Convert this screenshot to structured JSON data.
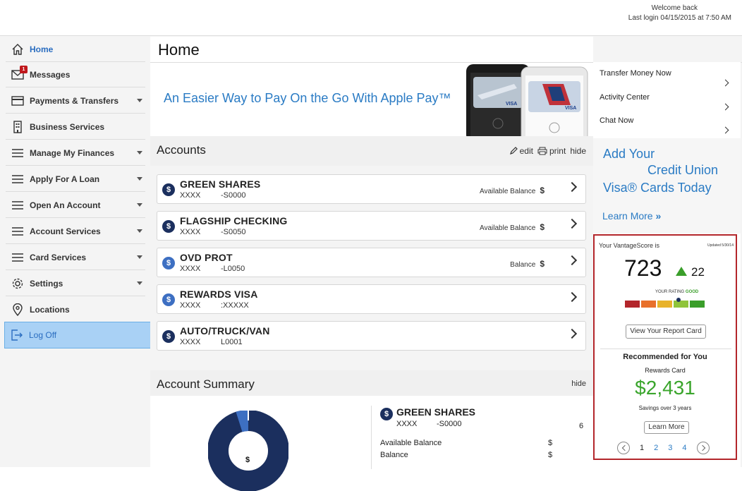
{
  "header": {
    "welcome": "Welcome back",
    "last_login": "Last login 04/15/2015 at 7:50 AM"
  },
  "sidebar": {
    "items": [
      {
        "label": "Home",
        "icon": "home-icon"
      },
      {
        "label": "Messages",
        "icon": "envelope-icon",
        "badge": "1"
      },
      {
        "label": "Payments & Transfers",
        "icon": "credit-card-icon"
      },
      {
        "label": "Business Services",
        "icon": "building-icon"
      },
      {
        "label": "Manage My Finances",
        "icon": "menu-icon"
      },
      {
        "label": "Apply For A Loan",
        "icon": "menu-icon"
      },
      {
        "label": "Open An Account",
        "icon": "menu-icon"
      },
      {
        "label": "Account Services",
        "icon": "menu-icon"
      },
      {
        "label": "Card Services",
        "icon": "menu-icon"
      },
      {
        "label": "Settings",
        "icon": "gear-icon"
      },
      {
        "label": "Locations",
        "icon": "location-pin-icon"
      },
      {
        "label": "Log Off",
        "icon": "logout-icon"
      }
    ]
  },
  "main": {
    "title": "Home",
    "promo": {
      "text": "An Easier Way to Pay On the Go With Apple Pay™",
      "card_brand": "VISA"
    },
    "accounts": {
      "title": "Accounts",
      "edit": "edit",
      "print": "print",
      "hide": "hide",
      "list": [
        {
          "name": "GREEN SHARES",
          "num_a": "XXXX",
          "num_b": "-S0000",
          "balance_label": "Available Balance",
          "balance": "$"
        },
        {
          "name": "FLAGSHIP CHECKING",
          "num_a": "XXXX",
          "num_b": "-S0050",
          "balance_label": "Available Balance",
          "balance": "$"
        },
        {
          "name": "OVD PROT",
          "num_a": "XXXX",
          "num_b": "-L0050",
          "balance_label": "Balance",
          "balance": "$"
        },
        {
          "name": "REWARDS VISA",
          "num_a": "XXXX",
          "num_b": ":XXXXX",
          "balance_label": "",
          "balance": ""
        },
        {
          "name": "AUTO/TRUCK/VAN",
          "num_a": "XXXX",
          "num_b": "L0001",
          "balance_label": "",
          "balance": ""
        }
      ]
    },
    "summary": {
      "title": "Account Summary",
      "hide": "hide",
      "donut_center": "$",
      "account": {
        "name": "GREEN SHARES",
        "num_a": "XXXX",
        "num_b": "-S0000",
        "extra": "6",
        "rows": [
          {
            "label": "Available Balance",
            "value": "$"
          },
          {
            "label": "Balance",
            "value": "$"
          }
        ]
      }
    }
  },
  "right": {
    "quick_links": [
      "Transfer Money Now",
      "Activity Center",
      "Chat Now"
    ],
    "visa_ad": {
      "line1": "Add Your",
      "line2": "Credit Union",
      "line3": "Visa® Cards Today",
      "learn_more": "Learn More"
    },
    "score": {
      "label": "Your VantageScore is",
      "updated": "Updated 5/30/14",
      "value": "723",
      "delta": "22",
      "rating_label": "YOUR RATING",
      "rating": "GOOD",
      "view_report": "View Your Report Card",
      "recommended": "Recommended for You",
      "product": "Rewards Card",
      "amount": "$2,431",
      "savings": "Savings over 3 years",
      "learn_more": "Learn More",
      "pages": [
        "1",
        "2",
        "3",
        "4"
      ],
      "current_page": "1",
      "colors": {
        "bar": [
          "#b3262b",
          "#e8702a",
          "#e8b32a",
          "#8fc43a",
          "#3a9e2a",
          "#2f8a22"
        ],
        "accent": "#3aa52c"
      }
    }
  },
  "colors": {
    "brand_blue": "#2a7bc4",
    "navy": "#1b2f5e",
    "active_bg": "#a9d1f5"
  }
}
